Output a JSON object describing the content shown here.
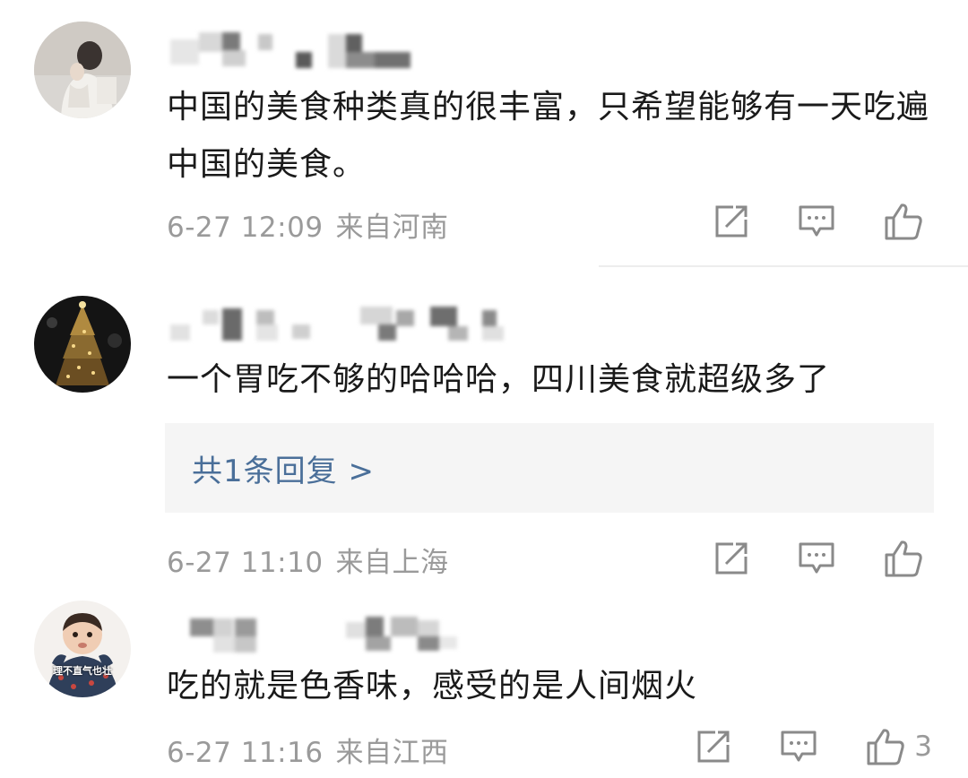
{
  "comments": [
    {
      "text": "中国的美食种类真的很丰富，只希望能够有一天吃遍中国的美食。",
      "date": "6-27 12:09",
      "location": "来自河南",
      "likes": ""
    },
    {
      "text": "一个胃吃不够的哈哈哈，四川美食就超级多了",
      "date": "6-27 11:10",
      "location": "来自上海",
      "likes": "",
      "replies": "共1条回复 >"
    },
    {
      "text": "吃的就是色香味，感受的是人间烟火",
      "date": "6-27 11:16",
      "location": "来自江西",
      "likes": "3",
      "avatar_caption": "理不直气也壮"
    }
  ],
  "icons": {
    "share": "share-icon",
    "comment": "comment-icon",
    "like": "like-icon"
  },
  "colors": {
    "reply_link": "#4a6f99",
    "meta_gray": "#9a9a9a",
    "reply_bg": "#f5f5f5"
  }
}
